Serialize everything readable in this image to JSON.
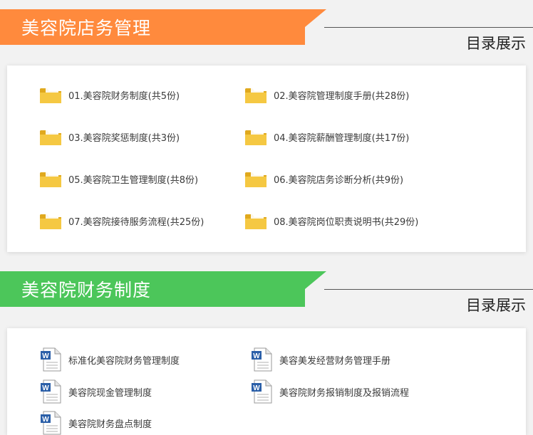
{
  "section1": {
    "title": "美容院店务管理",
    "catalog_label": "目录展示",
    "banner_color": "#ff8a3d",
    "items": [
      "01.美容院财务制度(共5份)",
      "02.美容院管理制度手册(共28份)",
      "03.美容院奖惩制度(共3份)",
      "04.美容院薪酬管理制度(共17份)",
      "05.美容院卫生管理制度(共8份)",
      "06.美容院店务诊断分析(共9份)",
      "07.美容院接待服务流程(共25份)",
      "08.美容院岗位职责说明书(共29份)"
    ]
  },
  "section2": {
    "title": "美容院财务制度",
    "catalog_label": "目录展示",
    "banner_color": "#4cc65a",
    "items": [
      "标准化美容院财务管理制度",
      "美容美发经营财务管理手册",
      "美容院现金管理制度",
      "美容院财务报销制度及报销流程",
      "美容院财务盘点制度"
    ]
  },
  "colors": {
    "folder": "#f5c842",
    "folder_dark": "#e0a91e",
    "word_blue": "#2b5fa8"
  },
  "icons": {
    "folder": "folder-icon",
    "document": "word-document-icon"
  }
}
